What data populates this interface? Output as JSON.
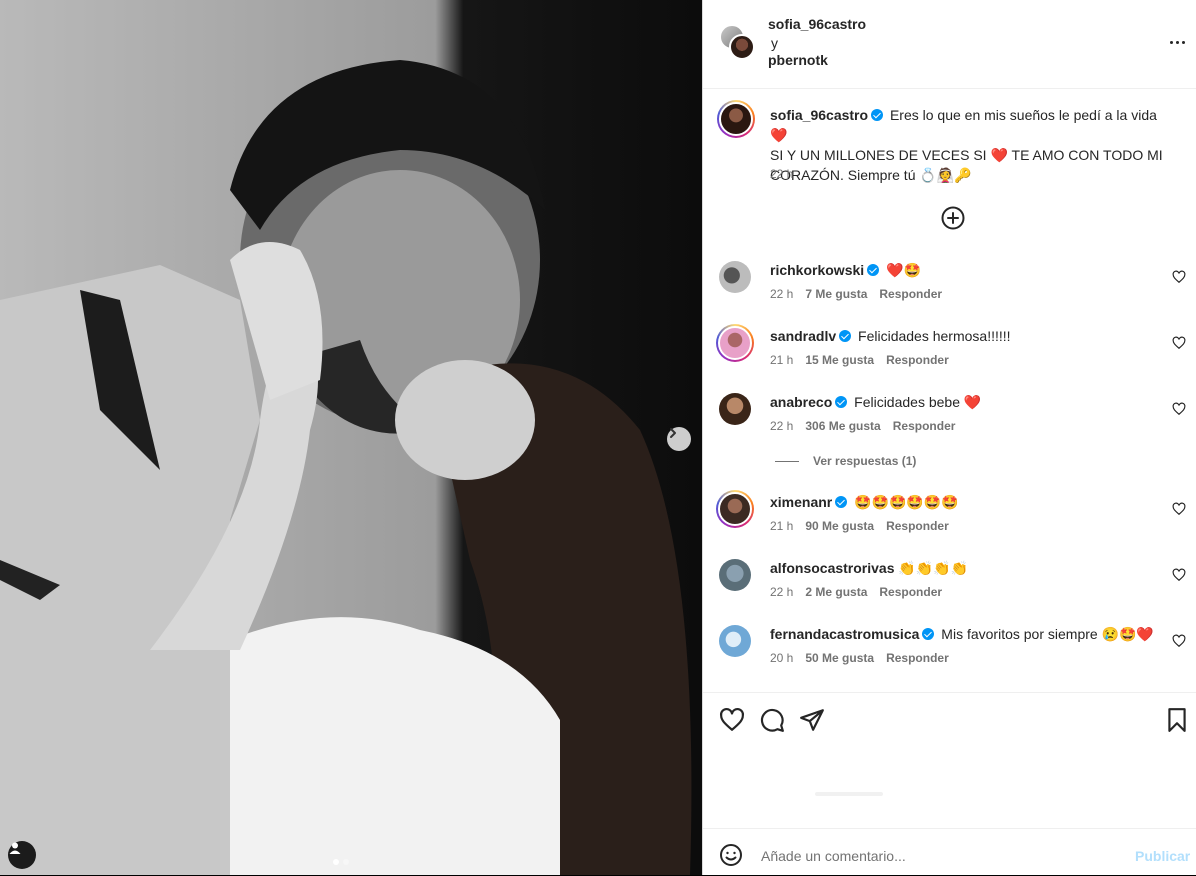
{
  "post": {
    "header": {
      "user1": "sofia_96castro",
      "conjunction": "y",
      "user2": "pbernotk",
      "more_icon": "more-horizontal-icon"
    },
    "caption": {
      "username": "sofia_96castro",
      "line1": "Eres lo que en mis sueños le pedí a la vida❤️",
      "line2": "SI Y UN MILLONES DE VECES SI ❤️ TE AMO CON TODO MI CORAZÓN. Siempre tú 💍👰🔑",
      "time": "22 h"
    },
    "comments": [
      {
        "username": "richkorkowski",
        "text": "❤️🤩",
        "time": "22 h",
        "likes": "7 Me gusta",
        "reply": "Responder"
      },
      {
        "username": "sandradlv",
        "text": "Felicidades hermosa!!!!!!",
        "time": "21 h",
        "likes": "15 Me gusta",
        "reply": "Responder"
      },
      {
        "username": "anabreco",
        "text": "Felicidades bebe ❤️",
        "time": "22 h",
        "likes": "306 Me gusta",
        "reply": "Responder"
      },
      {
        "username": "ximenanr",
        "text": "🤩🤩🤩🤩🤩🤩",
        "time": "21 h",
        "likes": "90 Me gusta",
        "reply": "Responder"
      },
      {
        "username": "alfonsocastrorivas",
        "text": "👏👏👏👏",
        "time": "22 h",
        "likes": "2 Me gusta",
        "reply": "Responder"
      },
      {
        "username": "fernandacastromusica",
        "text": "Mis favoritos por siempre 😢🤩❤️",
        "time": "20 h",
        "likes": "50 Me gusta",
        "reply": "Responder"
      }
    ],
    "view_replies": "Ver respuestas (1)",
    "comment_box": {
      "placeholder": "Añade un comentario...",
      "publish": "Publicar"
    }
  },
  "colors": {
    "verified": "#0095f6",
    "publish_disabled": "#b2dffc",
    "muted_text": "#737373"
  },
  "icons": [
    "heart-icon",
    "comment-icon",
    "share-icon",
    "bookmark-icon",
    "emoji-icon",
    "plus-circle-icon",
    "chevron-right-icon",
    "user-tag-icon",
    "verified-icon"
  ]
}
